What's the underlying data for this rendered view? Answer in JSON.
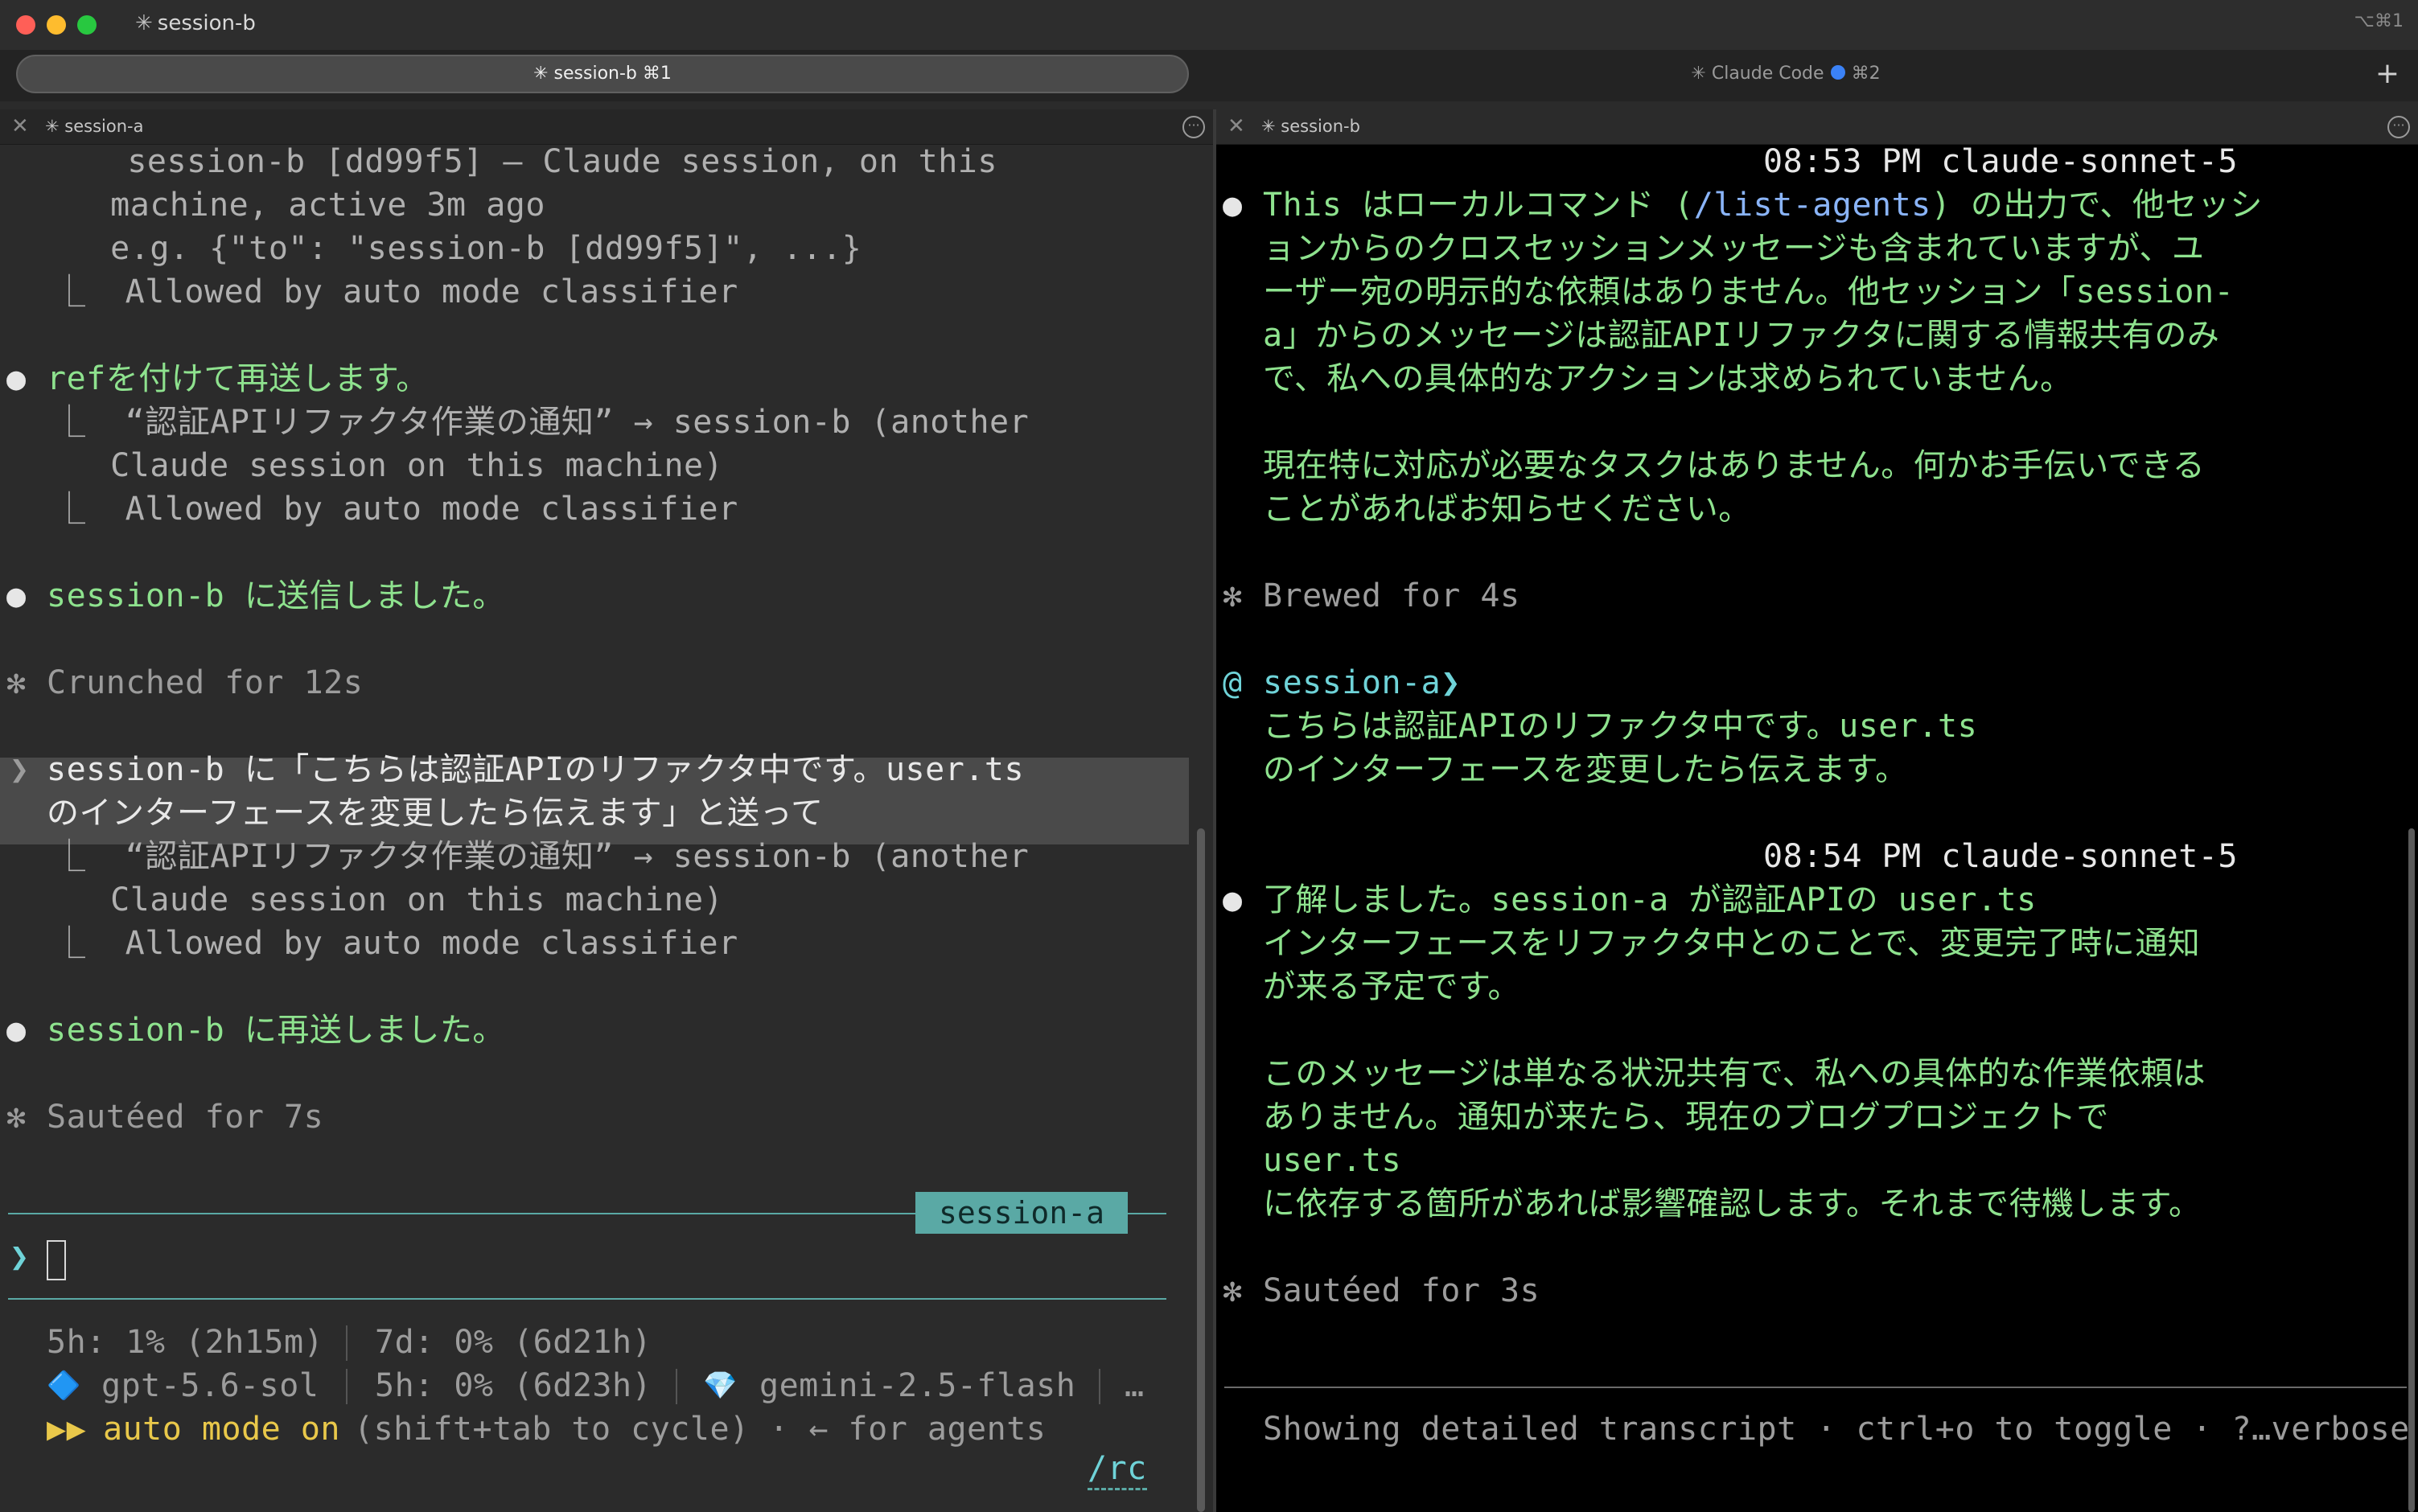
{
  "window": {
    "title": "session-b",
    "title_star": "✳",
    "shortcut_hint": "⌥⌘1"
  },
  "tabs": [
    {
      "label": "✳ session-b ⌘1",
      "active": true
    },
    {
      "label_prefix": "✳ Claude Code",
      "label_suffix": "⌘2",
      "active": false,
      "dot_color": "#3b82f6"
    }
  ],
  "new_tab_label": "+",
  "left_pane": {
    "header_title": "✳ session-a",
    "lines": {
      "l1": "    session-b [dd99f5] – Claude session, on this",
      "l2": "  machine, active 3m ago",
      "l3": "  e.g. {\"to\": \"session-b [dd99f5]\", ...}",
      "l4": "⎿  Allowed by auto mode classifier",
      "l5": "refを付けて再送します。",
      "l6": "⎿  “認証APIリファクタ作業の通知” → session-b (another",
      "l7": "  Claude session on this machine)",
      "l8": "⎿  Allowed by auto mode classifier",
      "l9": "session-b に送信しました。",
      "l10": "Crunched for 12s",
      "l11": "session-b に「こちらは認証APIのリファクタ中です。user.ts",
      "l12": "のインターフェースを変更したら伝えます」と送って",
      "l13": "⎿  “認証APIリファクタ作業の通知” → session-b (another",
      "l14": "  Claude session on this machine)",
      "l15": "⎿  Allowed by auto mode classifier",
      "l16": "session-b に再送しました。",
      "l17": "Sautéed for 7s"
    },
    "session_chip": "session-a",
    "prompt_symbol": "❯",
    "status": {
      "s1a": "5h: 1% (2h15m)",
      "s1b": "7d: 0% (6d21h)",
      "s2_icon": "🔷",
      "s2a": "gpt-5.6-sol",
      "s2b": "5h: 0% (6d23h)",
      "s2_icon2": "💎",
      "s2c": "gemini-2.5-flash",
      "s2_more": "…",
      "s3_prefix": "▶▶",
      "s3_mode": "auto mode on",
      "s3_rest": "(shift+tab to cycle) · ← for agents",
      "rc": "/rc"
    }
  },
  "right_pane": {
    "header_title": "✳ session-b",
    "lines": {
      "t1": "08:53 PM claude-sonnet-5",
      "r1a": "This はローカルコマンド (",
      "r1b": "/list-agents",
      "r1c": ") の出力で、他セッシ",
      "r2": "ョンからのクロスセッションメッセージも含まれていますが、ユ",
      "r3": "ーザー宛の明示的な依頼はありません。他セッション「session-",
      "r4": "a」からのメッセージは認証APIリファクタに関する情報共有のみ",
      "r5": "で、私への具体的なアクションは求められていません。",
      "r6": "現在特に対応が必要なタスクはありません。何かお手伝いできる",
      "r7": "ことがあればお知らせください。",
      "r8": "Brewed for 4s",
      "r9_at": "@",
      "r9": "session-a❯",
      "r10": "こちらは認証APIのリファクタ中です。user.ts",
      "r11": "のインターフェースを変更したら伝えます。",
      "t2": "08:54 PM claude-sonnet-5",
      "r12": "了解しました。session-a が認証APIの user.ts",
      "r13": "インターフェースをリファクタ中とのことで、変更完了時に通知",
      "r14": "が来る予定です。",
      "r15": "このメッセージは単なる状況共有で、私への具体的な作業依頼は",
      "r16": "ありません。通知が来たら、現在のブログプロジェクトで",
      "r17": "user.ts",
      "r18": "に依存する箇所があれば影響確認します。それまで待機します。",
      "r19": "Sautéed for 3s",
      "footer": "Showing detailed transcript · ctrl+o to toggle · ?…verbose"
    }
  },
  "glyphs": {
    "bullet": "●",
    "star": "✻",
    "close": "✕",
    "more": "···"
  },
  "colors": {
    "green_text": "#8ee28e",
    "accent_teal": "#5aa9a5",
    "yellow": "#e9c84a"
  }
}
